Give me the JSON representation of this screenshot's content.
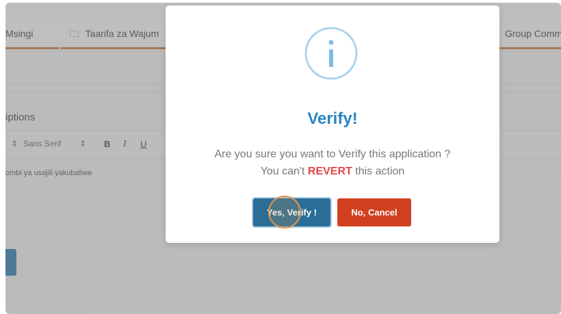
{
  "background": {
    "tabs": [
      {
        "label": "Msingi"
      },
      {
        "label": "Taarifa za Wajum",
        "icon": "folder-icon"
      },
      {
        "label": "Group Comm"
      }
    ],
    "section_title": "iptions",
    "editor": {
      "font_select": "Sans Serif",
      "bold": "B",
      "italic": "I",
      "underline": "U",
      "content": "ombi ya usajili yakubaliwe"
    }
  },
  "dialog": {
    "icon": "info-icon",
    "title": "Verify!",
    "message_line1": "Are you sure you want to Verify this application ?",
    "message_line2_pre": "You can't",
    "message_line2_em": "REVERT",
    "message_line2_post": "this action",
    "confirm_label": "Yes, Verify !",
    "cancel_label": "No, Cancel"
  },
  "colors": {
    "accent": "#2a86c4",
    "confirm": "#2a6e97",
    "cancel": "#d1401f",
    "warning_text": "#e24545"
  }
}
